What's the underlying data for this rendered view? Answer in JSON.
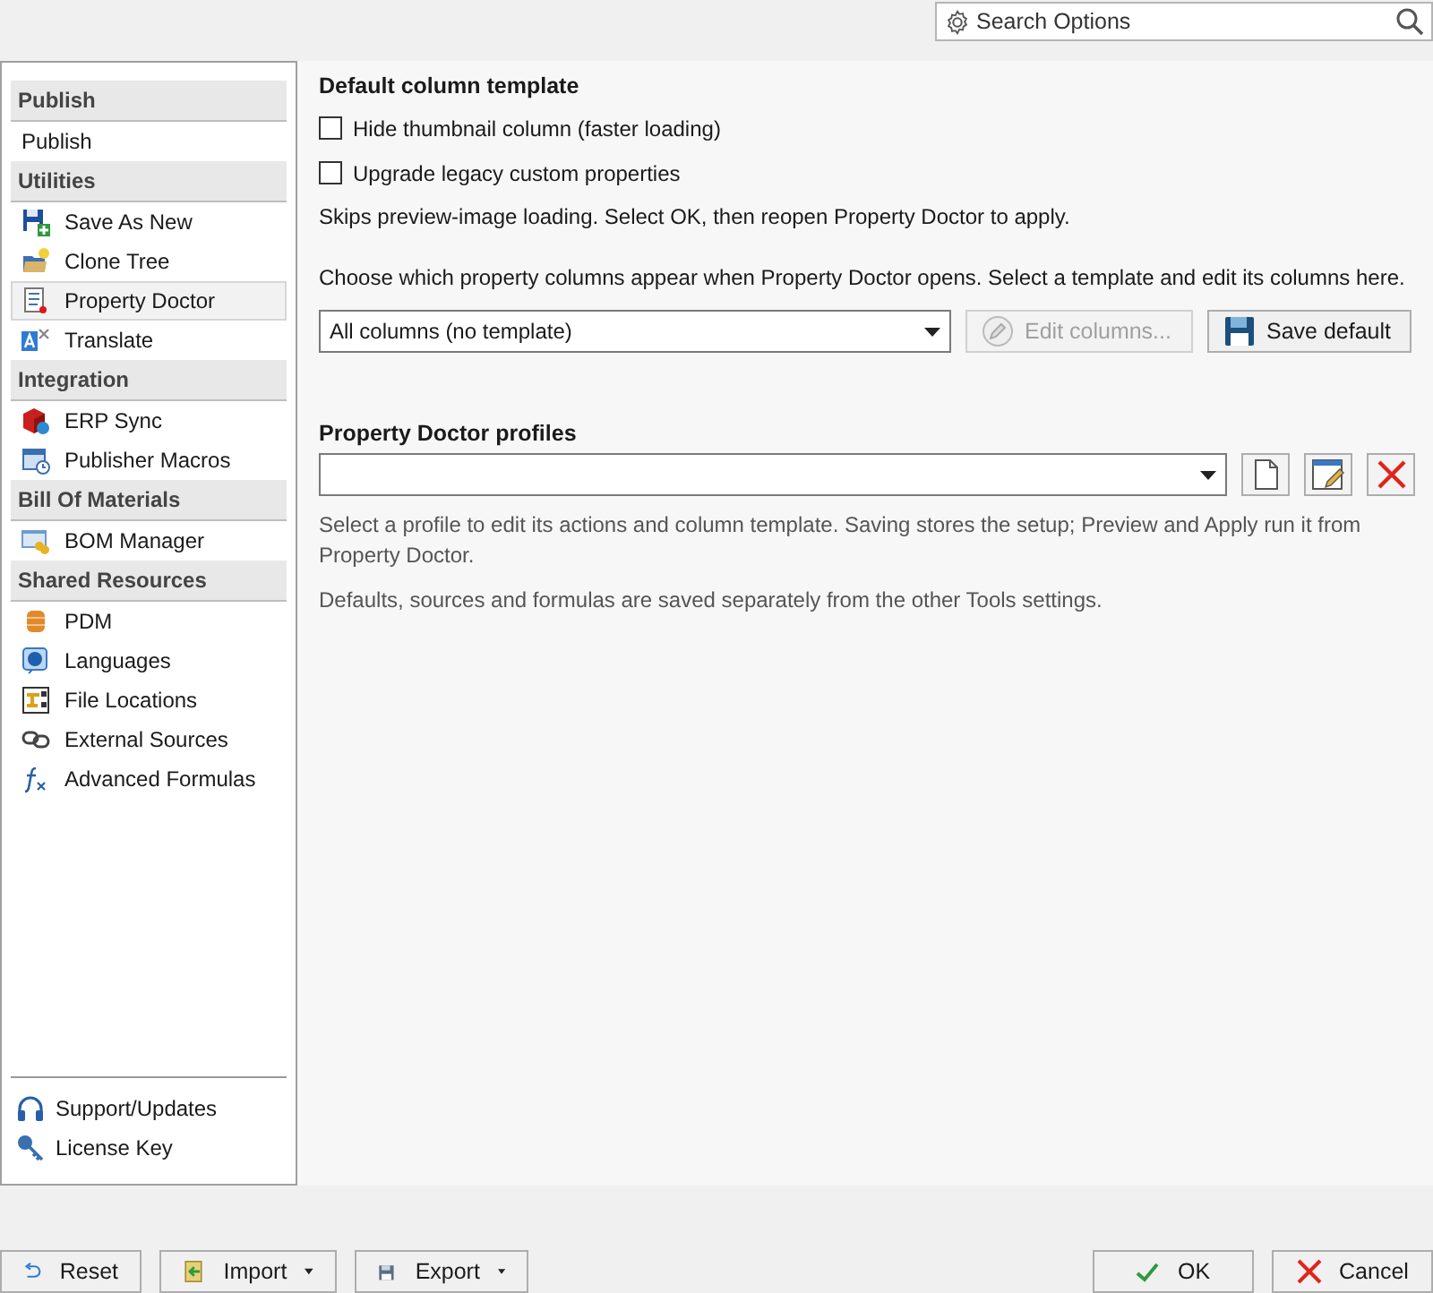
{
  "search": {
    "placeholder": "Search Options"
  },
  "sidebar": {
    "sections": [
      {
        "header": "Publish",
        "items": [
          {
            "label": "Publish",
            "selected": false
          }
        ]
      },
      {
        "header": "Utilities",
        "items": [
          {
            "label": "Save As New",
            "selected": false
          },
          {
            "label": "Clone Tree",
            "selected": false
          },
          {
            "label": "Property Doctor",
            "selected": true
          },
          {
            "label": "Translate",
            "selected": false
          }
        ]
      },
      {
        "header": "Integration",
        "items": [
          {
            "label": "ERP Sync",
            "selected": false
          },
          {
            "label": "Publisher Macros",
            "selected": false
          }
        ]
      },
      {
        "header": "Bill Of Materials",
        "items": [
          {
            "label": "BOM Manager",
            "selected": false
          }
        ]
      },
      {
        "header": "Shared Resources",
        "items": [
          {
            "label": "PDM",
            "selected": false
          },
          {
            "label": "Languages",
            "selected": false
          },
          {
            "label": "File Locations",
            "selected": false
          },
          {
            "label": "External Sources",
            "selected": false
          },
          {
            "label": "Advanced Formulas",
            "selected": false
          }
        ]
      }
    ],
    "footer": [
      {
        "label": "Support/Updates"
      },
      {
        "label": "License Key"
      }
    ]
  },
  "template": {
    "title": "Default column template",
    "checkboxes": [
      {
        "label": "Hide thumbnail column (faster loading)",
        "checked": false
      },
      {
        "label": "Upgrade legacy custom properties",
        "checked": false
      }
    ],
    "note": "Skips preview-image loading. Select OK, then reopen Property Doctor to apply.",
    "description": "Choose which property columns appear when Property Doctor opens. Select a template and edit its columns here.",
    "dropdown": {
      "value": "All columns (no template)"
    },
    "edit_button": {
      "label": "Edit columns...",
      "disabled": true
    },
    "save_button": {
      "label": "Save default"
    }
  },
  "profiles": {
    "title": "Property Doctor profiles",
    "help": [
      "Select a profile to edit its actions and column template. Saving stores the setup; Preview and Apply run it from Property Doctor.",
      "Defaults, sources and formulas are saved separately from the other Tools settings."
    ]
  },
  "footer_buttons": {
    "left": [
      {
        "label": "Reset",
        "menu": false
      },
      {
        "label": "Import",
        "menu": true
      },
      {
        "label": "Export",
        "menu": true
      }
    ],
    "right": [
      {
        "label": "OK"
      },
      {
        "label": "Cancel"
      }
    ]
  }
}
